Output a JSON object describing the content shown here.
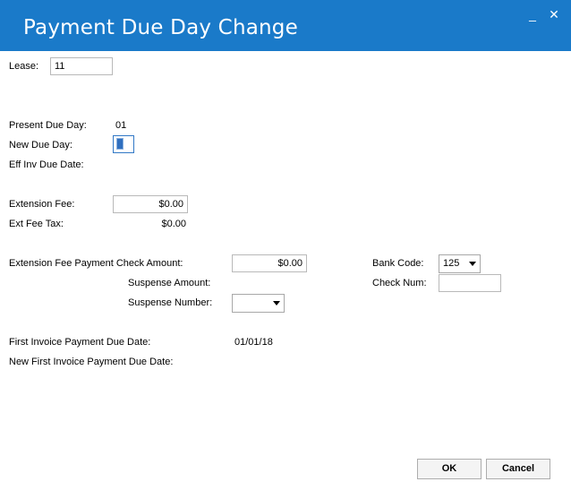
{
  "window": {
    "title": "Payment Due Day Change",
    "minimize_glyph": "_",
    "close_glyph": "✕"
  },
  "form": {
    "lease_label": "Lease:",
    "lease_value": "11",
    "present_due_day_label": "Present Due Day:",
    "present_due_day_value": "01",
    "new_due_day_label": "New Due Day:",
    "new_due_day_value": "",
    "eff_inv_due_date_label": "Eff Inv Due Date:",
    "eff_inv_due_date_value": "",
    "extension_fee_label": "Extension Fee:",
    "extension_fee_value": "$0.00",
    "ext_fee_tax_label": "Ext Fee Tax:",
    "ext_fee_tax_value": "$0.00",
    "check_amount_label": "Extension Fee Payment Check Amount:",
    "check_amount_value": "$0.00",
    "suspense_amount_label": "Suspense Amount:",
    "suspense_number_label": "Suspense Number:",
    "suspense_number_value": "",
    "bank_code_label": "Bank Code:",
    "bank_code_value": "125",
    "check_num_label": "Check Num:",
    "check_num_value": "",
    "first_invoice_label": "First Invoice Payment Due Date:",
    "first_invoice_value": "01/01/18",
    "new_first_invoice_label": "New First Invoice Payment Due Date:",
    "new_first_invoice_value": ""
  },
  "buttons": {
    "ok_label": "OK",
    "cancel_label": "Cancel"
  },
  "colors": {
    "titlebar": "#1a7ac9",
    "focus_border": "#3178c6"
  }
}
